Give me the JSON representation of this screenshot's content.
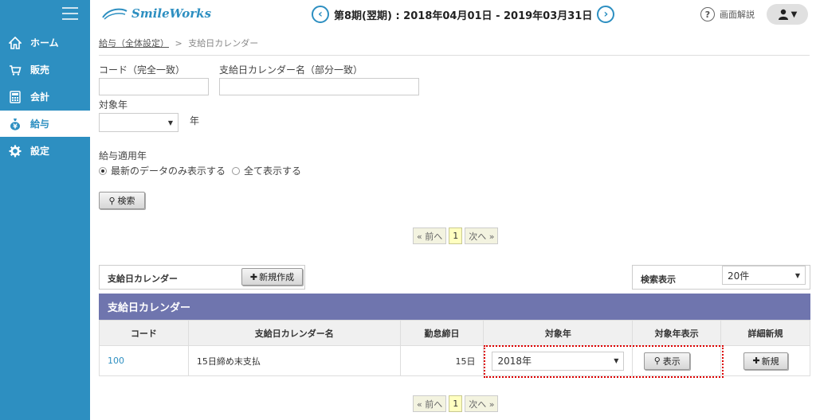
{
  "sidebar": {
    "items": [
      {
        "label": "ホーム",
        "icon": "home-icon"
      },
      {
        "label": "販売",
        "icon": "cart-icon"
      },
      {
        "label": "会計",
        "icon": "calculator-icon"
      },
      {
        "label": "給与",
        "icon": "money-bag-icon"
      },
      {
        "label": "設定",
        "icon": "gear-icon"
      }
    ],
    "active_index": 3
  },
  "header": {
    "logo_text": "SmileWorks",
    "period": "第8期(翌期) : 2018年04月01日 - 2019年03月31日",
    "help_label": "画面解説",
    "user_caret": "▼"
  },
  "breadcrumb": {
    "parent": "給与（全体設定）",
    "separator": ">",
    "current": "支給日カレンダー"
  },
  "search": {
    "code_label": "コード（完全一致）",
    "code_value": "",
    "name_label": "支給日カレンダー名（部分一致）",
    "name_value": "",
    "year_label": "対象年",
    "year_value": "",
    "year_suffix": "年",
    "apply_label": "給与適用年",
    "radio_latest": "最新のデータのみ表示する",
    "radio_all": "全て表示する",
    "search_button": "検索"
  },
  "pager": {
    "prev": "« 前へ",
    "current": "1",
    "next": "次へ »"
  },
  "list_panel": {
    "title": "支給日カレンダー",
    "new_button": "新規作成",
    "display_label": "検索表示",
    "display_value": "20件"
  },
  "table": {
    "title": "支給日カレンダー",
    "headers": [
      "コード",
      "支給日カレンダー名",
      "勤怠締日",
      "対象年",
      "対象年表示",
      "詳細新規"
    ],
    "rows": [
      {
        "code": "100",
        "name": "15日締め末支払",
        "close_day": "15日",
        "year": "2018年",
        "show_button": "表示",
        "new_button": "新規"
      }
    ]
  },
  "colors": {
    "sidebar": "#2d8fc1",
    "table_title": "#6f75ae",
    "highlight_border": "#dd0000"
  }
}
